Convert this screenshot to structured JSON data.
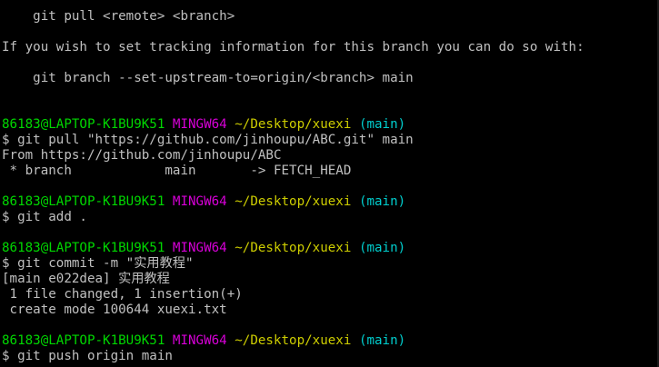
{
  "terminal": {
    "lines": [
      {
        "type": "text",
        "text": "    git pull <remote> <branch>"
      },
      {
        "type": "blank",
        "text": ""
      },
      {
        "type": "text",
        "text": "If you wish to set tracking information for this branch you can do so with:"
      },
      {
        "type": "blank",
        "text": ""
      },
      {
        "type": "text",
        "text": "    git branch --set-upstream-to=origin/<branch> main"
      },
      {
        "type": "blank",
        "text": ""
      },
      {
        "type": "blank",
        "text": ""
      },
      {
        "type": "prompt",
        "user": "86183@LAPTOP-K1BU9K51",
        "system": "MINGW64",
        "path": "~/Desktop/xuexi",
        "branch": "(main)"
      },
      {
        "type": "text",
        "text": "$ git pull \"https://github.com/jinhoupu/ABC.git\" main"
      },
      {
        "type": "text",
        "text": "From https://github.com/jinhoupu/ABC"
      },
      {
        "type": "text",
        "text": " * branch            main       -> FETCH_HEAD"
      },
      {
        "type": "blank",
        "text": ""
      },
      {
        "type": "prompt",
        "user": "86183@LAPTOP-K1BU9K51",
        "system": "MINGW64",
        "path": "~/Desktop/xuexi",
        "branch": "(main)"
      },
      {
        "type": "text",
        "text": "$ git add ."
      },
      {
        "type": "blank",
        "text": ""
      },
      {
        "type": "prompt",
        "user": "86183@LAPTOP-K1BU9K51",
        "system": "MINGW64",
        "path": "~/Desktop/xuexi",
        "branch": "(main)"
      },
      {
        "type": "text",
        "text": "$ git commit -m \"实用教程\""
      },
      {
        "type": "text",
        "text": "[main e022dea] 实用教程"
      },
      {
        "type": "text",
        "text": " 1 file changed, 1 insertion(+)"
      },
      {
        "type": "text",
        "text": " create mode 100644 xuexi.txt"
      },
      {
        "type": "blank",
        "text": ""
      },
      {
        "type": "prompt",
        "user": "86183@LAPTOP-K1BU9K51",
        "system": "MINGW64",
        "path": "~/Desktop/xuexi",
        "branch": "(main)"
      },
      {
        "type": "text",
        "text": "$ git push origin main"
      }
    ]
  },
  "colors": {
    "background": "#000000",
    "text": "#c0c0c0",
    "user": "#00d700",
    "system": "#d700d7",
    "path": "#cdcd00",
    "branch": "#00cdcd"
  }
}
